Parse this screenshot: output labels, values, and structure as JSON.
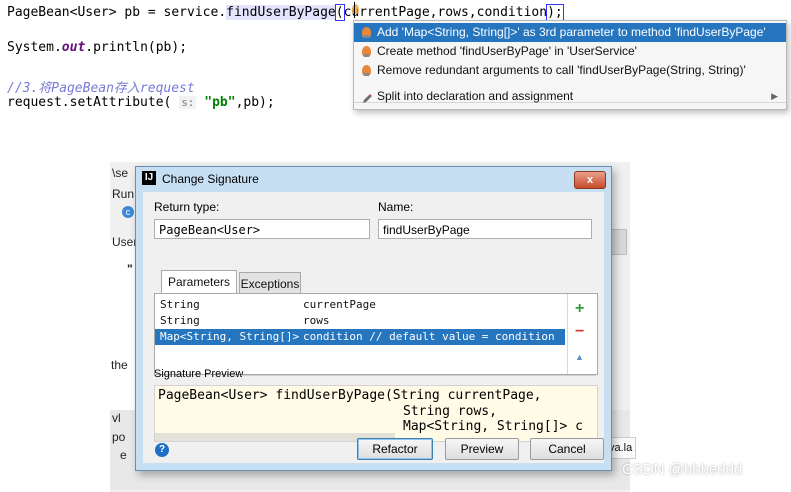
{
  "editor": {
    "line1_a": "PageBean<User> pb = service.",
    "line1_method": "findUserByPage",
    "line1_b": "(",
    "line1_args": "currentPage,rows,condition",
    "line1_c": ");",
    "line2_a": "System.",
    "line2_out": "out",
    "line2_b": ".println(pb);",
    "comment": "//3.将PageBean存入request",
    "line4_a": "request.setAttribute( ",
    "line4_hint": "s:",
    "line4_str": " \"pb\"",
    "line4_b": ",pb);"
  },
  "intention_popup": {
    "items": [
      {
        "label": "Add 'Map<String, String[]>' as 3rd parameter to method 'findUserByPage'",
        "icon": "bulb-icon"
      },
      {
        "label": "Create method 'findUserByPage' in 'UserService'",
        "icon": "bulb-icon"
      },
      {
        "label": "Remove redundant arguments to call 'findUserByPage(String, String)'",
        "icon": "bulb-icon"
      },
      {
        "label": "Split into declaration and assignment",
        "icon": "pencil-icon"
      }
    ],
    "submenu_arrow": "▶"
  },
  "background": {
    "frag_se": "\\se",
    "frag_un": "Run",
    "frag_c": "c",
    "frag_user": "User",
    "frag_quote": "\"",
    "frag_the": "the",
    "frag_vl": "vl",
    "frag_po": "po",
    "frag_e": "e",
    "frag_va": "va.la"
  },
  "dialog": {
    "title": "Change Signature",
    "app_icon": "IJ",
    "close_label": "x",
    "return_type_label": "Return type:",
    "return_type_value": "PageBean<User>",
    "name_label": "Name:",
    "name_value": "findUserByPage",
    "tabs": {
      "parameters": "Parameters",
      "exceptions": "Exceptions"
    },
    "parameters": [
      {
        "type": "String",
        "name": "currentPage"
      },
      {
        "type": "String",
        "name": "rows"
      },
      {
        "type": "Map<String, String[]>",
        "name": "condition // default value = condition"
      }
    ],
    "signature_preview_label": "Signature Preview",
    "signature_lines": [
      "PageBean<User> findUserByPage(String currentPage,",
      "String rows,",
      "Map<String, String[]> c"
    ],
    "help_label": "?",
    "refactor_label": "Refactor",
    "preview_label": "Preview",
    "cancel_label": "Cancel"
  },
  "watermark": "CSDN @bbbeddd",
  "colors": {
    "selection": "#2675bf",
    "dialog_frame": "#c7dff3",
    "preview_bg": "#fffbe6",
    "bulb": "#e8863a"
  }
}
